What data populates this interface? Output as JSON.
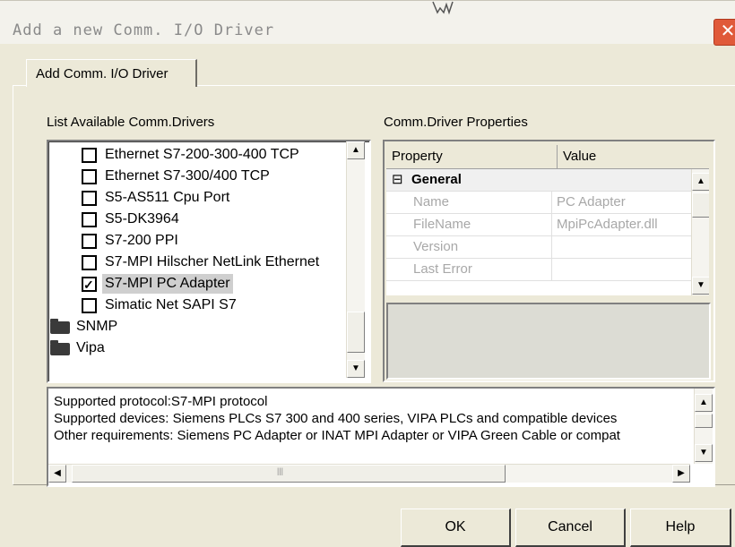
{
  "window": {
    "title": "Add a new Comm. I/O Driver",
    "close_glyph": "✕"
  },
  "tab": {
    "label": "Add Comm. I/O Driver"
  },
  "drivers": {
    "label": "List Available Comm.Drivers",
    "items": [
      {
        "label": "Ethernet S7-200-300-400 TCP",
        "checked": false
      },
      {
        "label": "Ethernet S7-300/400 TCP",
        "checked": false
      },
      {
        "label": "S5-AS511 Cpu Port",
        "checked": false
      },
      {
        "label": "S5-DK3964",
        "checked": false
      },
      {
        "label": "S7-200 PPI",
        "checked": false
      },
      {
        "label": "S7-MPI Hilscher NetLink Ethernet",
        "checked": false
      },
      {
        "label": "S7-MPI PC Adapter",
        "checked": true
      },
      {
        "label": "Simatic Net SAPI S7",
        "checked": false
      }
    ],
    "folders": [
      {
        "label": "SNMP"
      },
      {
        "label": "Vipa"
      }
    ]
  },
  "properties": {
    "label": "Comm.Driver Properties",
    "col_property": "Property",
    "col_value": "Value",
    "group_label": "General",
    "group_toggle": "⊟",
    "rows": [
      {
        "name": "Name",
        "value": "PC Adapter"
      },
      {
        "name": "FileName",
        "value": "MpiPcAdapter.dll"
      },
      {
        "name": "Version",
        "value": ""
      },
      {
        "name": "Last Error",
        "value": ""
      }
    ]
  },
  "description": {
    "lines": [
      "Supported protocol:S7-MPI protocol",
      "Supported devices: Siemens PLCs S7 300 and 400 series, VIPA PLCs and compatible devices",
      "Other requirements: Siemens PC Adapter or INAT MPI Adapter or VIPA Green Cable or compat"
    ]
  },
  "buttons": {
    "ok": "OK",
    "cancel": "Cancel",
    "help": "Help"
  },
  "colors": {
    "close_button": "#e05a3a",
    "dialog_bg": "#ece9d8",
    "selection": "#cfcfcf"
  }
}
